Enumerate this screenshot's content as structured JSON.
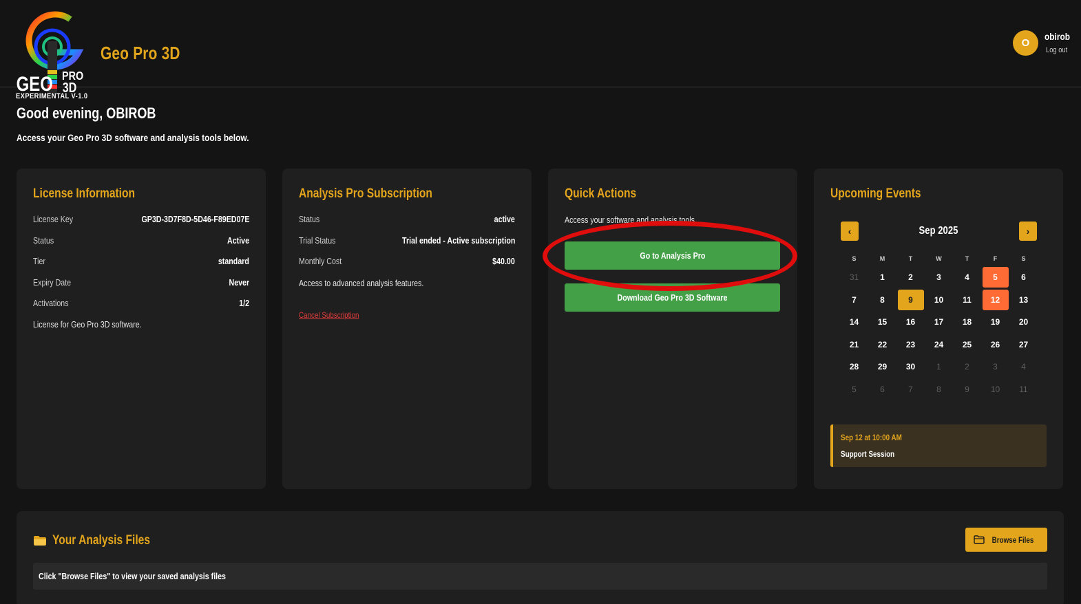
{
  "header": {
    "logo_text": "GEO PRO 3D",
    "logo_caption": "EXPERIMENTAL V-1.0",
    "app_title": "Geo Pro 3D",
    "user": {
      "avatar_initial": "O",
      "username": "obirob",
      "logout_label": "Log out"
    }
  },
  "welcome": {
    "greeting": "Good evening, OBIROB",
    "subtitle": "Access your Geo Pro 3D software and analysis tools below."
  },
  "license": {
    "title": "License Information",
    "rows": [
      {
        "label": "License Key",
        "value": "GP3D-3D7F8D-5D46-F89ED07E"
      },
      {
        "label": "Status",
        "value": "Active"
      },
      {
        "label": "Tier",
        "value": "standard"
      },
      {
        "label": "Expiry Date",
        "value": "Never"
      },
      {
        "label": "Activations",
        "value": "1/2"
      }
    ],
    "note": "License for Geo Pro 3D software."
  },
  "subscription": {
    "title": "Analysis Pro Subscription",
    "rows": [
      {
        "label": "Status",
        "value": "active"
      },
      {
        "label": "Trial Status",
        "value": "Trial ended - Active subscription"
      },
      {
        "label": "Monthly Cost",
        "value": "$40.00"
      }
    ],
    "note": "Access to advanced analysis features.",
    "cancel_label": "Cancel Subscription"
  },
  "quick_actions": {
    "title": "Quick Actions",
    "description": "Access your software and analysis tools",
    "primary_label": "Go to Analysis Pro",
    "download_label": "Download Geo Pro 3D Software"
  },
  "events": {
    "title": "Upcoming Events",
    "prev_label": "‹",
    "next_label": "›",
    "month_label": "Sep 2025",
    "weekdays": [
      "S",
      "M",
      "T",
      "W",
      "T",
      "F",
      "S"
    ],
    "days": [
      {
        "n": "31",
        "t": "muted"
      },
      {
        "n": "1",
        "t": ""
      },
      {
        "n": "2",
        "t": ""
      },
      {
        "n": "3",
        "t": ""
      },
      {
        "n": "4",
        "t": ""
      },
      {
        "n": "5",
        "t": "event"
      },
      {
        "n": "6",
        "t": ""
      },
      {
        "n": "7",
        "t": ""
      },
      {
        "n": "8",
        "t": ""
      },
      {
        "n": "9",
        "t": "today"
      },
      {
        "n": "10",
        "t": ""
      },
      {
        "n": "11",
        "t": ""
      },
      {
        "n": "12",
        "t": "event"
      },
      {
        "n": "13",
        "t": ""
      },
      {
        "n": "14",
        "t": ""
      },
      {
        "n": "15",
        "t": ""
      },
      {
        "n": "16",
        "t": ""
      },
      {
        "n": "17",
        "t": ""
      },
      {
        "n": "18",
        "t": ""
      },
      {
        "n": "19",
        "t": ""
      },
      {
        "n": "20",
        "t": ""
      },
      {
        "n": "21",
        "t": ""
      },
      {
        "n": "22",
        "t": ""
      },
      {
        "n": "23",
        "t": ""
      },
      {
        "n": "24",
        "t": ""
      },
      {
        "n": "25",
        "t": ""
      },
      {
        "n": "26",
        "t": ""
      },
      {
        "n": "27",
        "t": ""
      },
      {
        "n": "28",
        "t": ""
      },
      {
        "n": "29",
        "t": ""
      },
      {
        "n": "30",
        "t": ""
      },
      {
        "n": "1",
        "t": "muted"
      },
      {
        "n": "2",
        "t": "muted"
      },
      {
        "n": "3",
        "t": "muted"
      },
      {
        "n": "4",
        "t": "muted"
      },
      {
        "n": "5",
        "t": "muted"
      },
      {
        "n": "6",
        "t": "muted"
      },
      {
        "n": "7",
        "t": "muted"
      },
      {
        "n": "8",
        "t": "muted"
      },
      {
        "n": "9",
        "t": "muted"
      },
      {
        "n": "10",
        "t": "muted"
      },
      {
        "n": "11",
        "t": "muted"
      }
    ],
    "upcoming": {
      "date": "Sep 12 at 10:00 AM",
      "title": "Support Session"
    }
  },
  "files": {
    "title": "Your Analysis Files",
    "folder_icon": "folder-icon",
    "browse_label": "Browse Files",
    "empty_message": "Click \"Browse Files\" to view your saved analysis files"
  },
  "colors": {
    "accent": "#e3a51c",
    "background": "#141414",
    "card": "#1f1f1f",
    "button_green": "#43a047",
    "event_day": "#ff6b35",
    "highlight_oval": "#e00d0d"
  }
}
